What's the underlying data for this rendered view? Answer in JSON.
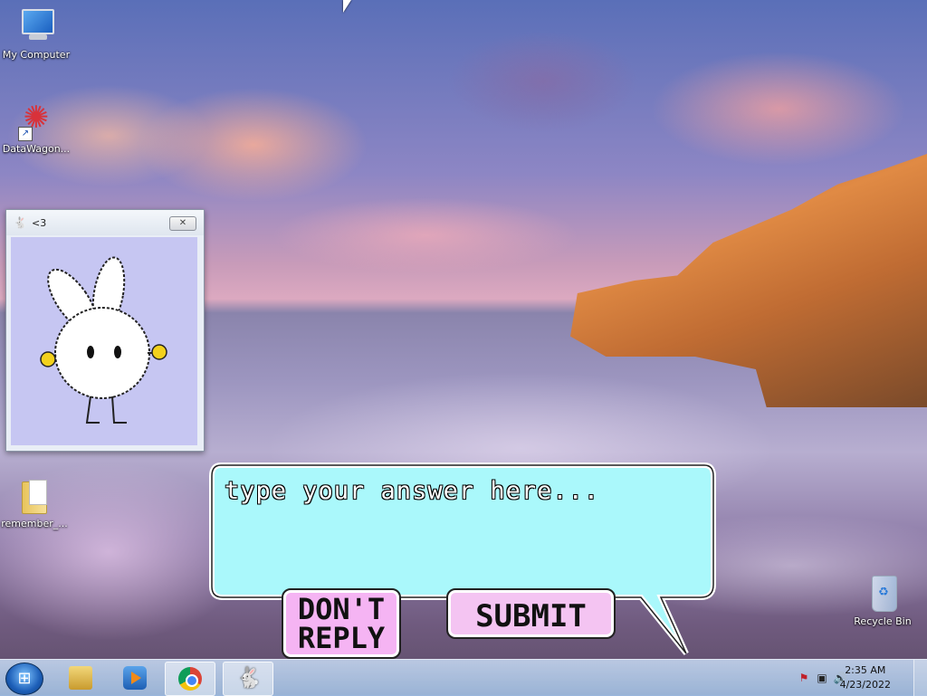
{
  "desktop": {
    "icons": [
      {
        "label": "My Computer"
      },
      {
        "label": "DataWagon..."
      },
      {
        "label": "remember_..."
      },
      {
        "label": "Recycle Bin"
      }
    ]
  },
  "bunny_window": {
    "title": "<3",
    "close_label": "✕"
  },
  "dialog": {
    "answer_placeholder": "type your answer here...",
    "answer_value": "",
    "dont_reply_label": "DON'T REPLY",
    "submit_label": "SUBMIT",
    "bubble_color": "#aaf8fb",
    "button_color": "#f5b4f3"
  },
  "taskbar": {
    "pinned": [
      {
        "name": "windows-explorer"
      },
      {
        "name": "windows-media-player"
      },
      {
        "name": "google-chrome"
      },
      {
        "name": "bunny-app"
      }
    ],
    "clock_time": "2:35 AM",
    "clock_date": "4/23/2022"
  }
}
